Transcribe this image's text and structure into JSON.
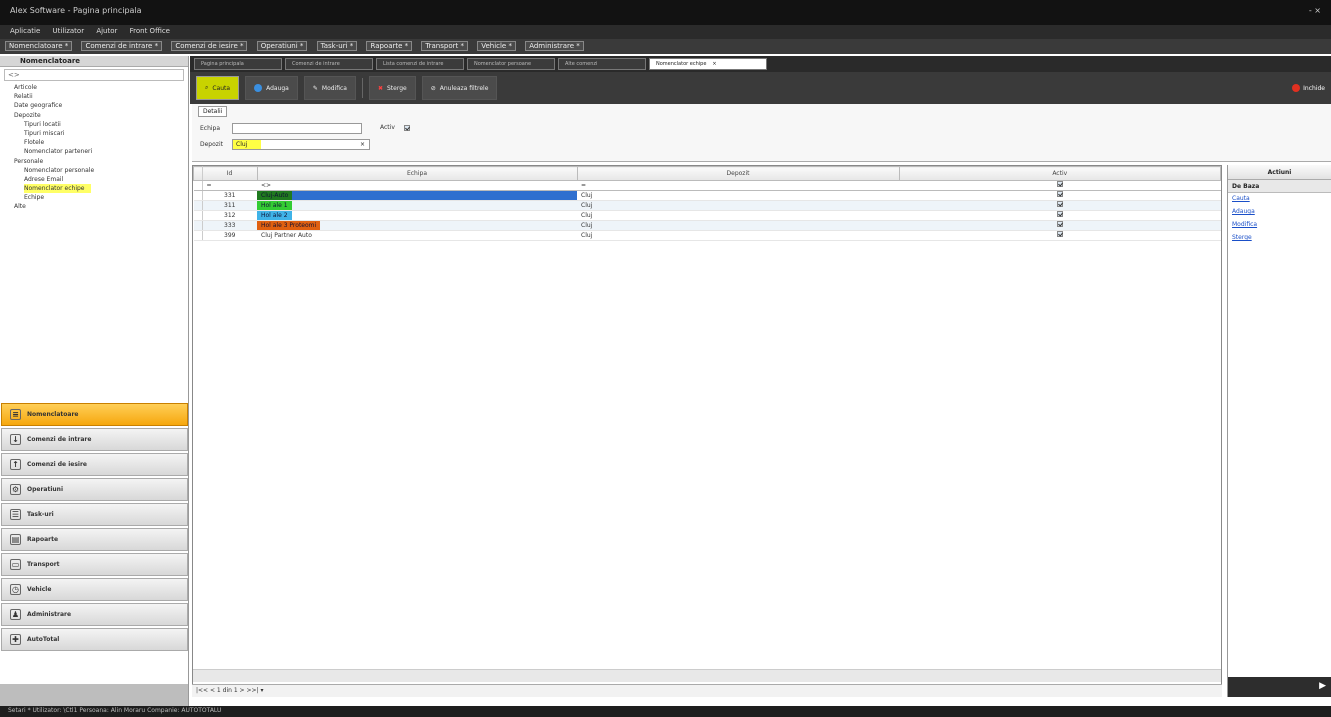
{
  "titlebar": {
    "title": "Alex Software - Pagina principala",
    "controls": "- ×"
  },
  "menubar": {
    "items": [
      "Aplicatie",
      "Utilizator",
      "Ajutor",
      "Front Office"
    ]
  },
  "navbar": {
    "items": [
      "Nomenclatoare *",
      "Comenzi de intrare *",
      "Comenzi de iesire *",
      "Operatiuni *",
      "Task-uri *",
      "Rapoarte *",
      "Transport *",
      "Vehicle *",
      "Administrare *"
    ]
  },
  "leftpanel": {
    "header": "Nomenclatoare",
    "search_placeholder": "<>",
    "tree": [
      {
        "label": "Articole",
        "level": 0
      },
      {
        "label": "Relatii",
        "level": 0
      },
      {
        "label": "Date geografice",
        "level": 0
      },
      {
        "label": "Depozite",
        "level": 0
      },
      {
        "label": "Tipuri locatii",
        "level": 1
      },
      {
        "label": "Tipuri miscari",
        "level": 1
      },
      {
        "label": "Flotele",
        "level": 1
      },
      {
        "label": "Nomenclator parteneri",
        "level": 1
      },
      {
        "label": "Personale",
        "level": 0
      },
      {
        "label": "Nomenclator personale",
        "level": 1
      },
      {
        "label": "Adrese Email",
        "level": 1
      },
      {
        "label": "Nomenclator echipe",
        "level": 1,
        "highlight": true
      },
      {
        "label": "Echipe",
        "level": 1
      },
      {
        "label": "Alte",
        "level": 0
      }
    ],
    "nav_buttons": [
      {
        "label": "Nomenclatoare",
        "icon": "database-icon",
        "glyph": "≡",
        "active": true
      },
      {
        "label": "Comenzi de intrare",
        "icon": "inbound-icon",
        "glyph": "↓"
      },
      {
        "label": "Comenzi de iesire",
        "icon": "outbound-icon",
        "glyph": "↑"
      },
      {
        "label": "Operatiuni",
        "icon": "operations-icon",
        "glyph": "⚙"
      },
      {
        "label": "Task-uri",
        "icon": "tasks-icon",
        "glyph": "☰"
      },
      {
        "label": "Rapoarte",
        "icon": "reports-icon",
        "glyph": "▤"
      },
      {
        "label": "Transport",
        "icon": "truck-icon",
        "glyph": "▭"
      },
      {
        "label": "Vehicle",
        "icon": "vehicle-icon",
        "glyph": "◷"
      },
      {
        "label": "Administrare",
        "icon": "users-icon",
        "glyph": "♟"
      },
      {
        "label": "AutoTotal",
        "icon": "puzzle-icon",
        "glyph": "✚"
      }
    ]
  },
  "tabs": [
    {
      "label": "Pagina principala"
    },
    {
      "label": "Comenzi de intrare"
    },
    {
      "label": "Lista comenzi de intrare"
    },
    {
      "label": "Nomenclator persoane"
    },
    {
      "label": "Alte comenzi"
    },
    {
      "label": "Nomenclator echipe",
      "active": true,
      "close": "×"
    }
  ],
  "toolbar": {
    "cauta": "Cauta",
    "adauga": "Adauga",
    "modifica": "Modifica",
    "sterge": "Sterge",
    "anuleaza": "Anuleaza filtrele",
    "inchide": "Inchide"
  },
  "filter": {
    "tab": "Detalii",
    "echipa_label": "Echipa",
    "echipa_value": "",
    "activ_label": "Activ",
    "depozit_label": "Depozit",
    "depozit_value": "Cluj",
    "clear": "×"
  },
  "grid": {
    "columns": [
      "Id",
      "Echipa",
      "Depozit",
      "Activ"
    ],
    "filter_row": [
      "=",
      "<>",
      "=",
      ""
    ],
    "rows": [
      {
        "id": "331",
        "echipa": "Cluj-Auto",
        "depozit": "Cluj",
        "activ": true,
        "color": "#1f7a1f",
        "selected": true
      },
      {
        "id": "311",
        "echipa": "Hol ale 1",
        "depozit": "Cluj",
        "activ": true,
        "color": "#33cc33"
      },
      {
        "id": "312",
        "echipa": "Hol ale 2",
        "depozit": "Cluj",
        "activ": true,
        "color": "#3fb3e8"
      },
      {
        "id": "333",
        "echipa": "Hol ale 3 Proteomi",
        "depozit": "Cluj",
        "activ": true,
        "color": "#e06010"
      },
      {
        "id": "399",
        "echipa": "Cluj Partner Auto",
        "depozit": "Cluj",
        "activ": true,
        "color": ""
      }
    ],
    "pager": "|<< < 1 din 1 > >>| ▾"
  },
  "actions": {
    "header": "Actiuni",
    "group": "De Baza",
    "links": [
      "Cauta",
      "Adauga",
      "Modifica",
      "Sterge"
    ],
    "bottom_glyph": "▶"
  },
  "statusbar": {
    "text": "Setari *   Utilizator:  \\Ctl1  Persoana:  Alin Moraru  Companie:  AUTOTOTALU"
  },
  "colors": {
    "accent": "#f6a70e",
    "toolbar_yellow": "#c8d300",
    "selection": "#2f6fcf"
  }
}
